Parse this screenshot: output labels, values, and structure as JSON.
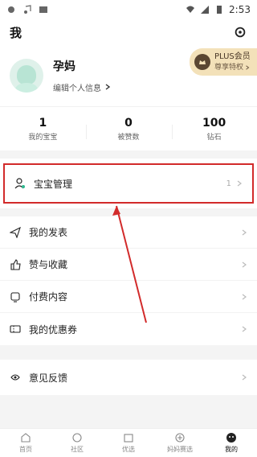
{
  "status_bar": {
    "time": "2:53"
  },
  "header": {
    "title": "我"
  },
  "profile": {
    "name": "孕妈",
    "edit_label": "编辑个人信息",
    "plus_title": "PLUS会员",
    "plus_sub": "尊享特权"
  },
  "stats": [
    {
      "value": "1",
      "label": "我的宝宝"
    },
    {
      "value": "0",
      "label": "被赞数"
    },
    {
      "value": "100",
      "label": "钻石"
    }
  ],
  "menu_group1": {
    "item": {
      "label": "宝宝管理",
      "count": "1"
    }
  },
  "menu_group2": [
    {
      "label": "我的发表"
    },
    {
      "label": "赞与收藏"
    },
    {
      "label": "付费内容"
    },
    {
      "label": "我的优惠券"
    }
  ],
  "menu_group3": [
    {
      "label": "意见反馈"
    }
  ],
  "bottom_nav": [
    {
      "label": "首页"
    },
    {
      "label": "社区"
    },
    {
      "label": "优选"
    },
    {
      "label": "妈妈赛选"
    },
    {
      "label": "我的"
    }
  ],
  "colors": {
    "highlight_border": "#d22b2b",
    "arrow": "#d22b2b",
    "plus_bg": "#f3e1b9"
  }
}
